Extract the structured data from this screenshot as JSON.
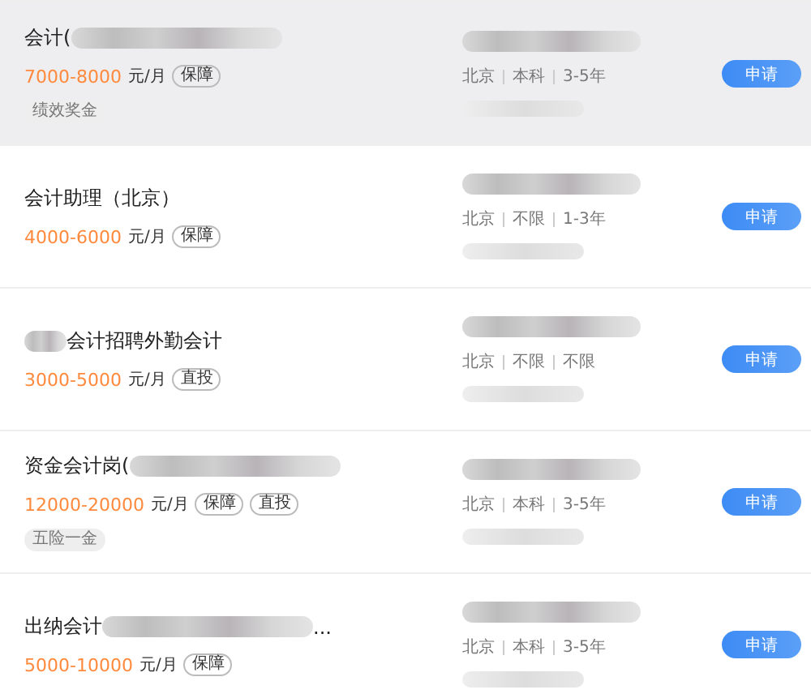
{
  "jobs": [
    {
      "highlighted": true,
      "kind": "tail_blurred",
      "title": "会计(",
      "salary": "7000-8000",
      "unit": "元/月",
      "badges": [
        "保障"
      ],
      "benefits": [
        "绩效奖金"
      ],
      "location": "北京",
      "education": "本科",
      "experience": "3-5年",
      "button": "申请"
    },
    {
      "highlighted": false,
      "kind": "plain",
      "title": "会计助理（北京）",
      "salary": "4000-6000",
      "unit": "元/月",
      "badges": [
        "保障"
      ],
      "location": "北京",
      "education": "不限",
      "experience": "1-3年",
      "button": "申请"
    },
    {
      "highlighted": false,
      "kind": "head_blurred",
      "title": "会计招聘外勤会计",
      "salary": "3000-5000",
      "unit": "元/月",
      "badges": [
        "直投"
      ],
      "location": "北京",
      "education": "不限",
      "experience": "不限",
      "button": "申请"
    },
    {
      "highlighted": false,
      "kind": "tail_blurred",
      "title": "资金会计岗(",
      "salary": "12000-20000",
      "unit": "元/月",
      "badges": [
        "保障",
        "直投"
      ],
      "benefits": [
        "五险一金"
      ],
      "location": "北京",
      "education": "本科",
      "experience": "3-5年",
      "button": "申请"
    },
    {
      "highlighted": false,
      "kind": "tail_blurred",
      "title": "出纳会计",
      "title_tail": "...",
      "salary": "5000-10000",
      "unit": "元/月",
      "badges": [
        "保障"
      ],
      "location": "北京",
      "education": "本科",
      "experience": "3-5年",
      "button": "申请"
    }
  ]
}
